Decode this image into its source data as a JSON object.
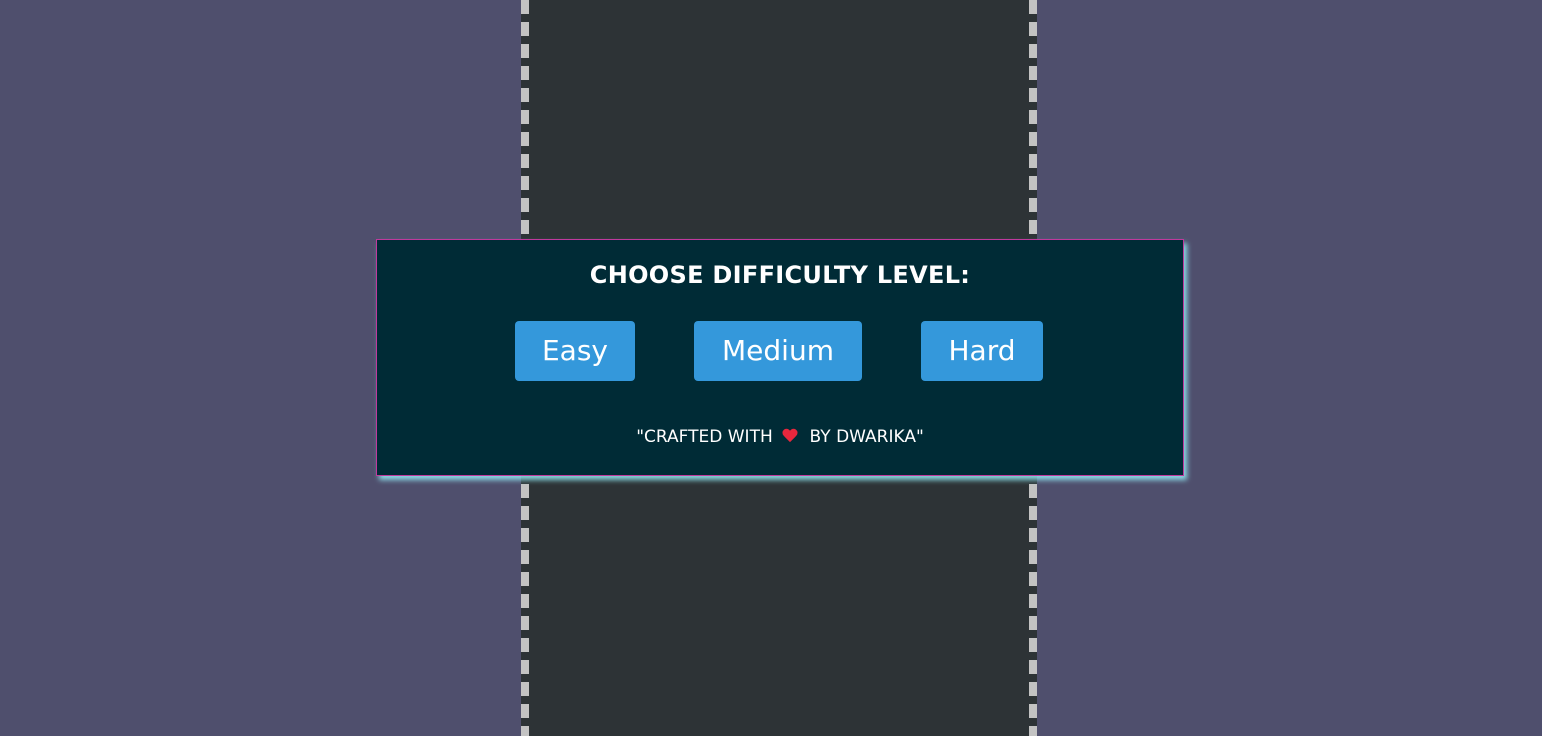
{
  "modal": {
    "title": "CHOOSE DIFFICULTY LEVEL:",
    "buttons": {
      "easy": "Easy",
      "medium": "Medium",
      "hard": "Hard"
    },
    "credit": {
      "prefix": "\"CRAFTED WITH",
      "icon": "heart-icon",
      "suffix": "BY DWARIKA\""
    }
  },
  "colors": {
    "background": "#4f4f6d",
    "road": "#2d3336",
    "road_dash": "#c3c3c3",
    "modal_bg": "#002b36",
    "modal_border": "#c0399d",
    "modal_glow": "#96f0fa",
    "button": "#3498db",
    "heart": "#e8273d"
  }
}
